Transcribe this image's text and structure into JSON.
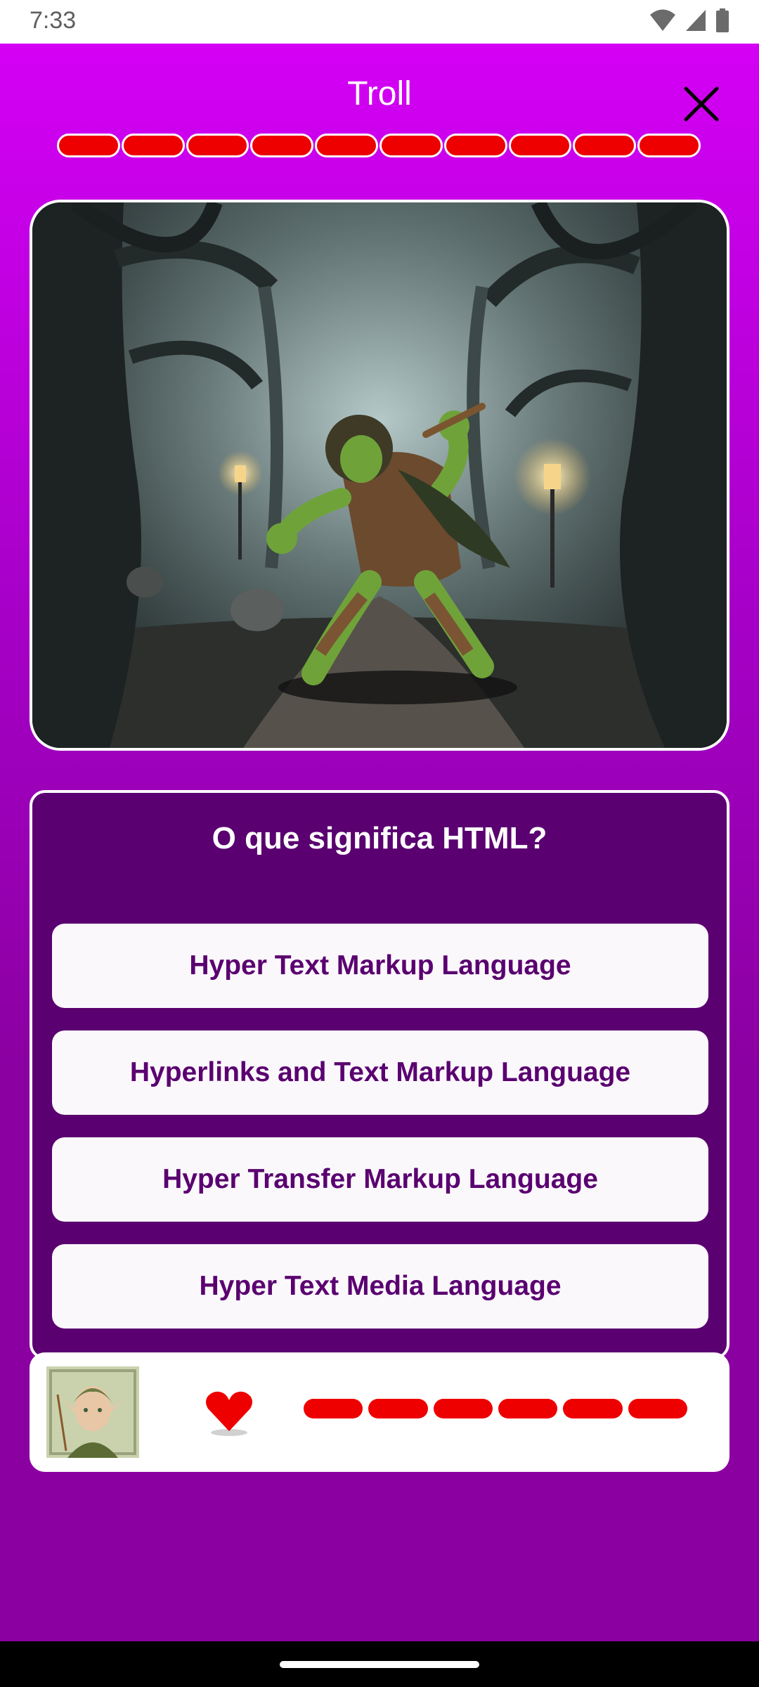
{
  "status_bar": {
    "time": "7:33",
    "icons": [
      "wifi-icon",
      "cellular-signal-icon",
      "battery-icon"
    ]
  },
  "header": {
    "title": "Troll",
    "close_icon": "close-icon"
  },
  "enemy_health": {
    "segments_total": 10,
    "segments_filled": 10,
    "color": "#ee0000"
  },
  "scene": {
    "image": "troll-in-haunted-forest-illustration"
  },
  "quiz": {
    "question": "O que significa HTML?",
    "answers": [
      "Hyper Text Markup Language",
      "Hyperlinks and Text Markup Language",
      "Hyper Transfer Markup Language",
      "Hyper Text Media Language"
    ]
  },
  "player": {
    "avatar": "elf-archer-avatar",
    "heart_icon": "heart-icon",
    "health_segments_total": 6,
    "health_segments_filled": 6,
    "color": "#ee0000"
  },
  "colors": {
    "background_top": "#d400f5",
    "background_bottom": "#8a00a0",
    "card": "#5a0070",
    "answer_text": "#5a0070"
  }
}
